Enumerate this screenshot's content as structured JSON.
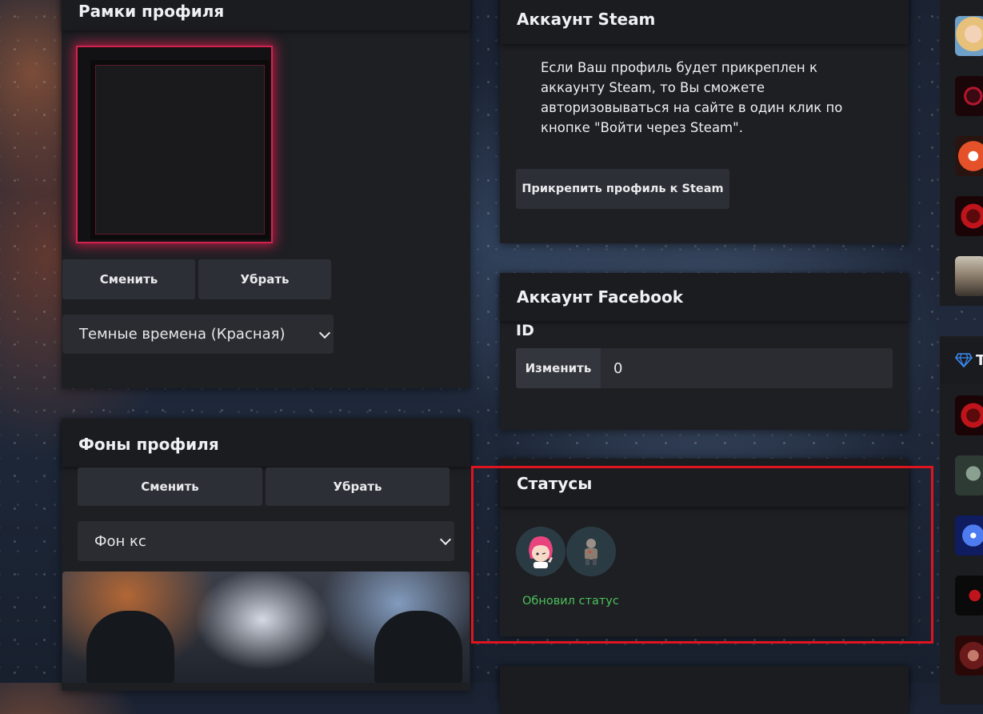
{
  "frames_panel": {
    "title": "Рамки профиля",
    "change_label": "Сменить",
    "remove_label": "Убрать",
    "selected_frame": "Темные времена (Красная)"
  },
  "backgrounds_panel": {
    "title": "Фоны профиля",
    "change_label": "Сменить",
    "remove_label": "Убрать",
    "selected_background": "Фон кс"
  },
  "steam_panel": {
    "title": "Аккаунт Steam",
    "description": "Если Ваш профиль будет прикреплен к аккаунту Steam, то Вы сможете авторизовываться на сайте в один клик по кнопке \"Войти через Steam\".",
    "link_button": "Прикрепить профиль к Steam"
  },
  "facebook_panel": {
    "title": "Аккаунт Facebook",
    "id_label": "ID",
    "change_label": "Изменить",
    "id_value": "0"
  },
  "statuses_panel": {
    "title": "Статусы",
    "updated_text": "Обновил статус"
  },
  "colors": {
    "panel_bg": "#1e1f23",
    "accent_red": "#e0141e",
    "status_green": "#4cc05a",
    "frame_glow": "#d42250"
  },
  "icons": {
    "status_1": "anime-girl-avatar",
    "status_2": "figure-avatar",
    "diamond": "diamond-icon"
  }
}
